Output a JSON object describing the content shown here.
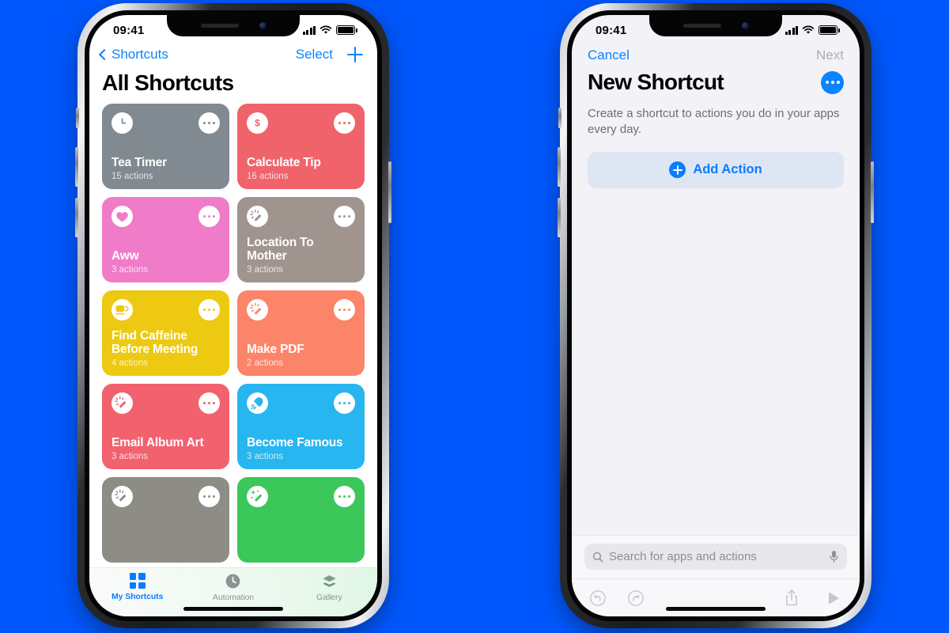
{
  "background_color": "#0057fb",
  "left_phone": {
    "status_bar": {
      "time": "09:41",
      "signal_icon": "cellular-bars-icon",
      "wifi_icon": "wifi-icon",
      "battery_icon": "battery-full-icon"
    },
    "nav": {
      "back_label": "Shortcuts",
      "back_icon": "chevron-left-icon",
      "select_label": "Select",
      "add_icon": "plus-icon"
    },
    "page_title": "All Shortcuts",
    "shortcuts": [
      {
        "name": "Tea Timer",
        "actions": "15 actions",
        "color": "#808a90",
        "icon": "clock-icon"
      },
      {
        "name": "Calculate Tip",
        "actions": "16 actions",
        "color": "#f0636a",
        "icon": "dollar-icon"
      },
      {
        "name": "Aww",
        "actions": "3 actions",
        "color": "#f07bc8",
        "icon": "heart-icon"
      },
      {
        "name": "Location To Mother",
        "actions": "3 actions",
        "color": "#a0948f",
        "icon": "magic-wand-icon"
      },
      {
        "name": "Find Caffeine Before Meeting",
        "actions": "4 actions",
        "color": "#edc911",
        "icon": "coffee-cup-icon"
      },
      {
        "name": "Make PDF",
        "actions": "2 actions",
        "color": "#fb8469",
        "icon": "magic-wand-icon"
      },
      {
        "name": "Email Album Art",
        "actions": "3 actions",
        "color": "#f2616e",
        "icon": "magic-wand-icon"
      },
      {
        "name": "Become Famous",
        "actions": "3 actions",
        "color": "#27b6f0",
        "icon": "rocket-icon"
      },
      {
        "name": "",
        "actions": "",
        "color": "#8d8d86",
        "icon": "magic-wand-icon"
      },
      {
        "name": "",
        "actions": "",
        "color": "#3cc75a",
        "icon": "sparkle-wand-icon"
      }
    ],
    "tabs": [
      {
        "label": "My Shortcuts",
        "icon": "grid-squares-icon",
        "active": true
      },
      {
        "label": "Automation",
        "icon": "clock-arrow-icon",
        "active": false
      },
      {
        "label": "Gallery",
        "icon": "layers-icon",
        "active": false
      }
    ]
  },
  "right_phone": {
    "status_bar": {
      "time": "09:41",
      "signal_icon": "cellular-bars-icon",
      "wifi_icon": "wifi-icon",
      "battery_icon": "battery-full-icon"
    },
    "nav": {
      "cancel_label": "Cancel",
      "next_label": "Next"
    },
    "page_title": "New Shortcut",
    "more_icon": "ellipsis-circle-icon",
    "description": "Create a shortcut to actions you do in your apps every day.",
    "add_action_label": "Add Action",
    "add_action_icon": "plus-circle-icon",
    "search": {
      "placeholder": "Search for apps and actions",
      "search_icon": "search-icon",
      "mic_icon": "microphone-icon"
    },
    "toolbar": [
      {
        "name": "undo",
        "icon": "undo-circle-icon"
      },
      {
        "name": "redo",
        "icon": "redo-circle-icon"
      },
      {
        "name": "share",
        "icon": "share-icon"
      },
      {
        "name": "play",
        "icon": "play-icon"
      }
    ]
  }
}
